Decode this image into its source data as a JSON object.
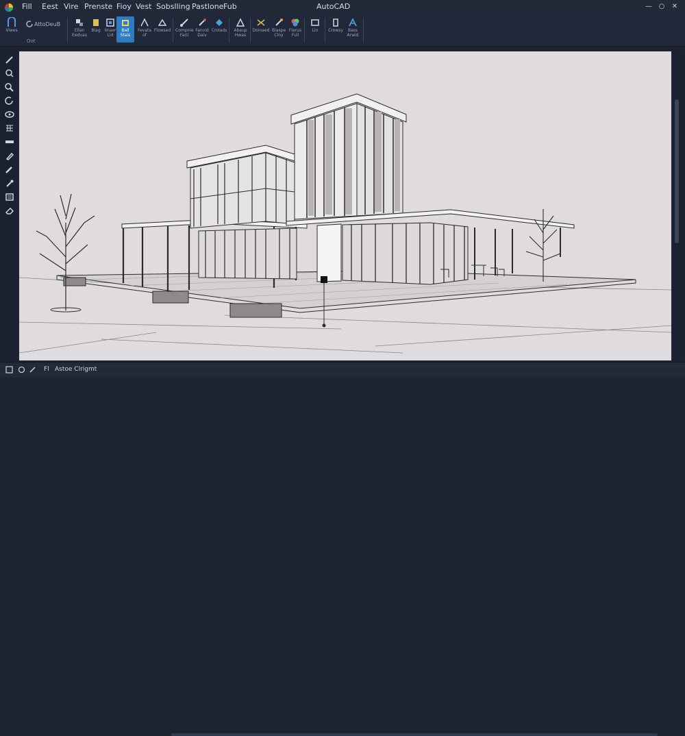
{
  "app": {
    "title": "AutoCAD"
  },
  "menu": {
    "items": [
      "Fill",
      "Eest",
      "Vire",
      "Prenste",
      "Fioy",
      "Vest",
      "Sobslling",
      "Pastlone",
      "Fub"
    ]
  },
  "window_controls": {
    "minimize": "—",
    "restore": "○",
    "close": "✕"
  },
  "ribbon": {
    "brand_label": "AttoDeuB",
    "group_label": "Oot",
    "tools": [
      {
        "label": "Viwes"
      },
      {
        "label": "Ellan\nEedvas"
      },
      {
        "label": "Blag"
      },
      {
        "label": "Iinaer\nLid"
      },
      {
        "label": "Ball\nStais"
      },
      {
        "label": "Fevata\nof"
      },
      {
        "label": "Flowsed"
      },
      {
        "label": "Compnie\nFaril"
      },
      {
        "label": "Fanvid\nDaiv"
      },
      {
        "label": "Crolads"
      },
      {
        "label": "Abaup\nHwas"
      },
      {
        "label": "Doinaed"
      },
      {
        "label": "Blaspe\nClny"
      },
      {
        "label": "Flarus\nFull"
      },
      {
        "label": "Lin"
      },
      {
        "label": "Crowsy"
      },
      {
        "label": "Bass\nArwid"
      }
    ],
    "active_tool_index": 4,
    "accent_color": "#2e7cc4"
  },
  "left_toolbar": {
    "icons": [
      "pencil-icon",
      "lasso-icon",
      "zoom-icon",
      "rotate-icon",
      "orbit-icon",
      "grid-icon",
      "line-icon",
      "pen-icon",
      "brush-icon",
      "eyedropper-icon",
      "layers-icon",
      "eraser-icon"
    ]
  },
  "statusbar": {
    "label": "Astoe Clrigmt",
    "extra": "Fl"
  },
  "viewport": {
    "background": "#e0dcdd",
    "line_color": "#2a2a2a"
  }
}
